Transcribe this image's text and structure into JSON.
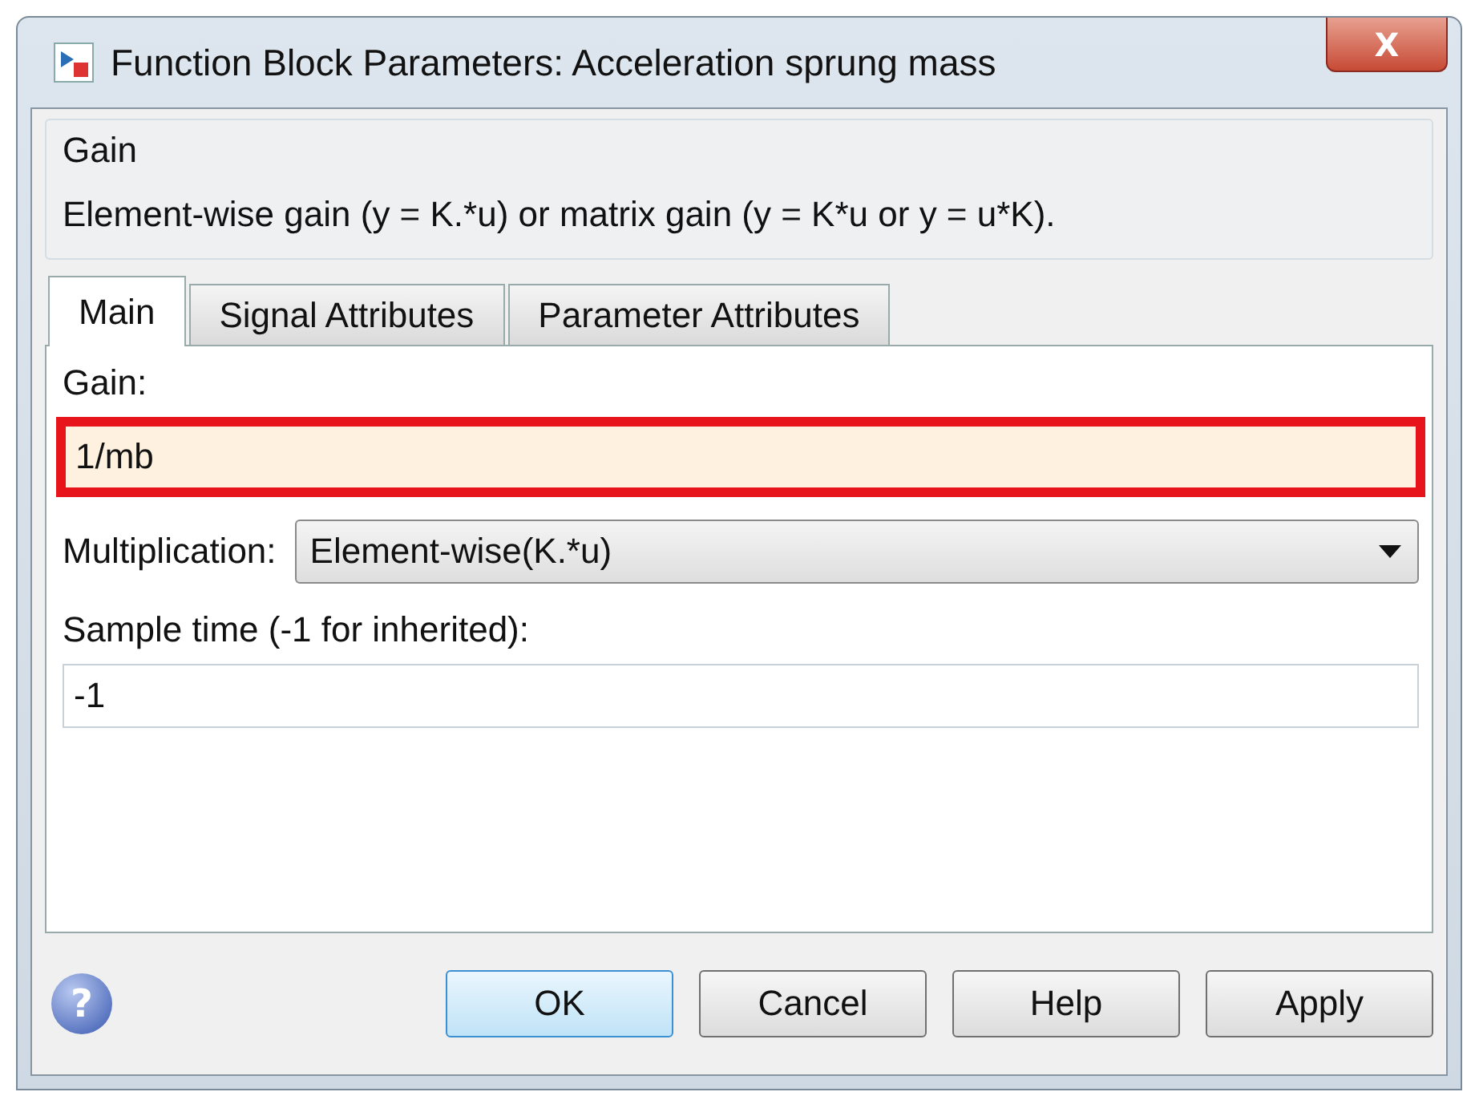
{
  "window": {
    "title": "Function Block Parameters: Acceleration sprung mass",
    "close": "X"
  },
  "group": {
    "title": "Gain",
    "description": "Element-wise gain (y = K.*u) or matrix gain (y = K*u or y = u*K)."
  },
  "tabs": [
    {
      "label": "Main",
      "selected": true
    },
    {
      "label": "Signal Attributes",
      "selected": false
    },
    {
      "label": "Parameter Attributes",
      "selected": false
    }
  ],
  "gain": {
    "label": "Gain:",
    "value": "1/mb",
    "highlighted": true
  },
  "multiplication": {
    "label": "Multiplication:",
    "value": "Element-wise(K.*u)"
  },
  "sample_time": {
    "label": "Sample time (-1 for inherited):",
    "value": "-1"
  },
  "help_icon": "?",
  "buttons": [
    {
      "label": "OK",
      "default": true
    },
    {
      "label": "Cancel",
      "default": false
    },
    {
      "label": "Help",
      "default": false
    },
    {
      "label": "Apply",
      "default": false
    }
  ]
}
